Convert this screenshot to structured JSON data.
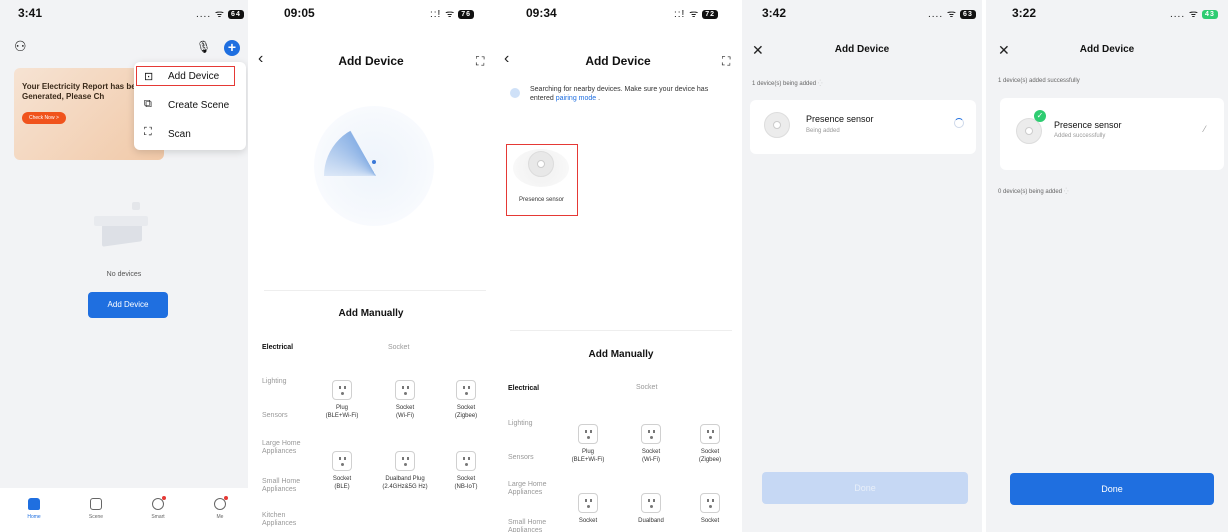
{
  "colors": {
    "accent": "#1f6fe0",
    "highlight": "#e53935",
    "success": "#2ecc71",
    "orange": "#f0531c"
  },
  "screen1": {
    "time": "3:41",
    "status": "....",
    "battery": "64",
    "banner_text": "Your Electricity Report has been Generated, Please Ch",
    "banner_button": "Check Now >",
    "menu": [
      {
        "icon": "add-device-icon",
        "label": "Add Device"
      },
      {
        "icon": "create-scene-icon",
        "label": "Create Scene"
      },
      {
        "icon": "scan-icon",
        "label": "Scan"
      }
    ],
    "empty_text": "No devices",
    "add_button": "Add Device",
    "tabs": [
      "Home",
      "Scene",
      "Smart",
      "Me"
    ]
  },
  "screen2": {
    "time": "09:05",
    "status": "::!",
    "battery": "76",
    "title": "Add Device",
    "manual_title": "Add Manually",
    "categories": [
      "Electrical",
      "Lighting",
      "Sensors",
      "Large Home Appliances",
      "Small Home Appliances",
      "Kitchen Appliances"
    ],
    "socket_header": "Socket",
    "sockets": [
      "Plug\n(BLE+Wi-Fi)",
      "Socket\n(Wi-Fi)",
      "Socket\n(Zigbee)",
      "Socket\n(BLE)",
      "Dualband Plug\n(2.4GHz&5G Hz)",
      "Socket\n(NB-IoT)"
    ]
  },
  "screen3": {
    "time": "09:34",
    "status": "::!",
    "battery": "72",
    "title": "Add Device",
    "search_text": "Searching for nearby devices. Make sure your device has entered",
    "pairing_link": "pairing mode",
    "search_suffix": ".",
    "found_device": "Presence sensor",
    "manual_title": "Add Manually",
    "categories": [
      "Electrical",
      "Lighting",
      "Sensors",
      "Large Home Appliances",
      "Small Home Appliances"
    ],
    "socket_header": "Socket",
    "sockets": [
      "Plug\n(BLE+Wi-Fi)",
      "Socket\n(Wi-Fi)",
      "Socket\n(Zigbee)",
      "Socket",
      "Dualband",
      "Socket"
    ]
  },
  "screen4": {
    "time": "3:42",
    "status": "....",
    "battery": "63",
    "title": "Add Device",
    "progress_text": "1 device(s) being added",
    "device_name": "Presence sensor",
    "device_status": "Being added",
    "done_button": "Done"
  },
  "screen5": {
    "time": "3:22",
    "status": "....",
    "battery": "43",
    "title": "Add Device",
    "success_text": "1 device(s) added successfully",
    "device_name": "Presence sensor",
    "device_status": "Added successfully",
    "adding_text": "0 device(s) being added",
    "done_button": "Done"
  }
}
